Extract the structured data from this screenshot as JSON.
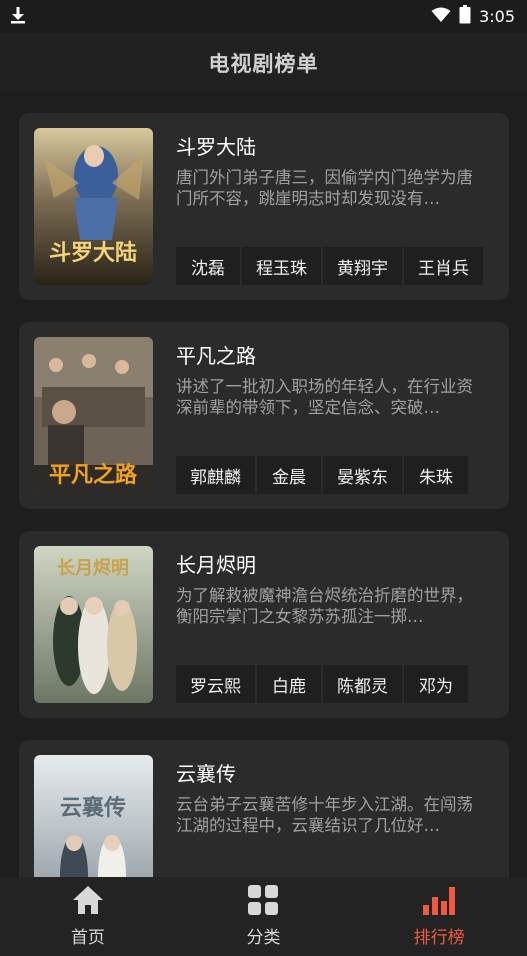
{
  "status_bar": {
    "time": "3:05",
    "icons": [
      "download-icon",
      "wifi-icon",
      "battery-icon"
    ]
  },
  "app_bar": {
    "title": "电视剧榜单"
  },
  "items": [
    {
      "title": "斗罗大陆",
      "description": "唐门外门弟子唐三，因偷学内门绝学为唐门所不容，跳崖明志时却发现没有…",
      "cast": [
        "沈磊",
        "程玉珠",
        "黄翔宇",
        "王肖兵"
      ],
      "poster_text": "斗罗大陆"
    },
    {
      "title": "平凡之路",
      "description": "讲述了一批初入职场的年轻人，在行业资深前辈的带领下，坚定信念、突破…",
      "cast": [
        "郭麒麟",
        "金晨",
        "晏紫东",
        "朱珠"
      ],
      "poster_text": "平凡之路"
    },
    {
      "title": "长月烬明",
      "description": "为了解救被魔神澹台烬统治折磨的世界，衡阳宗掌门之女黎苏苏孤注一掷…",
      "cast": [
        "罗云熙",
        "白鹿",
        "陈都灵",
        "邓为"
      ],
      "poster_text": "长月烬明"
    },
    {
      "title": "云襄传",
      "description": "云台弟子云襄苦修十年步入江湖。在闯荡江湖的过程中，云襄结识了几位好…",
      "cast": [],
      "poster_text": "云襄传"
    }
  ],
  "bottom_nav": {
    "home": "首页",
    "category": "分类",
    "ranking": "排行榜"
  },
  "colors": {
    "accent": "#ef5b41",
    "background": "#1e1e1e",
    "card": "#2b2b2b",
    "chip": "#1f1f1f"
  }
}
